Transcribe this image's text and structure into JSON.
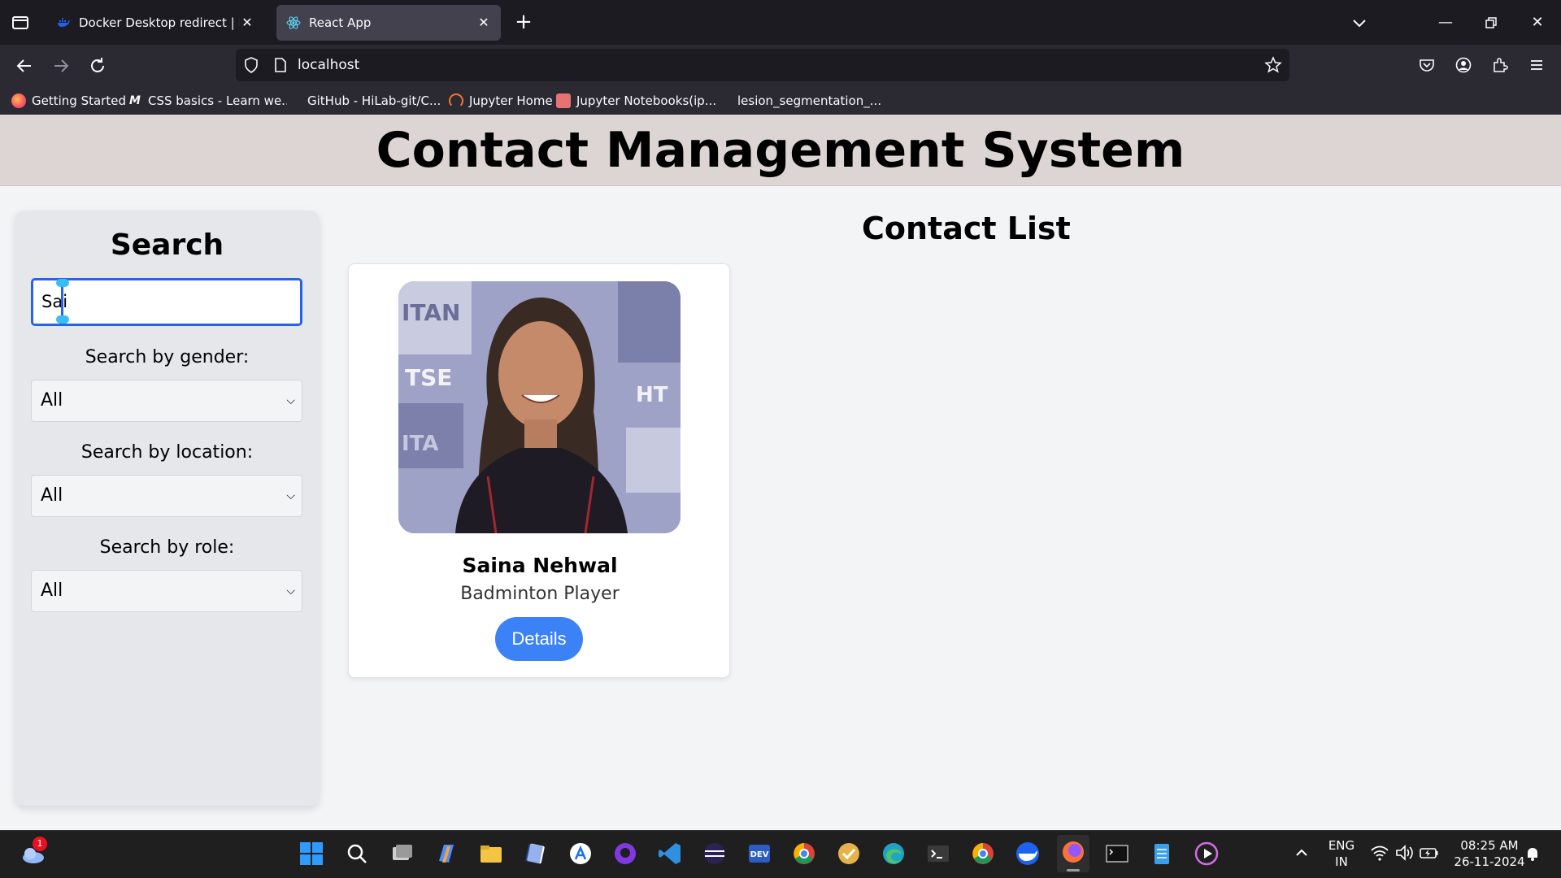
{
  "browser": {
    "tabs": [
      {
        "title": "Docker Desktop redirect | Dock",
        "active": false
      },
      {
        "title": "React App",
        "active": true
      }
    ],
    "url": "localhost",
    "bookmarks": [
      {
        "label": "Getting Started"
      },
      {
        "label": "CSS basics - Learn we..."
      },
      {
        "label": "GitHub - HiLab-git/C..."
      },
      {
        "label": "Jupyter Home"
      },
      {
        "label": "Jupyter Notebooks(ip..."
      },
      {
        "label": "lesion_segmentation_..."
      }
    ]
  },
  "app": {
    "title": "Contact Management System",
    "sidebar": {
      "heading": "Search",
      "search_value": "Sai",
      "gender_label": "Search by gender:",
      "gender_value": "All",
      "location_label": "Search by location:",
      "location_value": "All",
      "role_label": "Search by role:",
      "role_value": "All"
    },
    "list_title": "Contact List",
    "contacts": [
      {
        "name": "Saina Nehwal",
        "role": "Badminton Player",
        "button": "Details"
      }
    ]
  },
  "taskbar": {
    "notification_badge": "1",
    "language": "ENG",
    "region": "IN",
    "time": "08:25 AM",
    "date": "26-11-2024"
  },
  "colors": {
    "accent": "#3b82f6",
    "header_bg": "#dcd5d3",
    "search_border": "#2563eb"
  }
}
